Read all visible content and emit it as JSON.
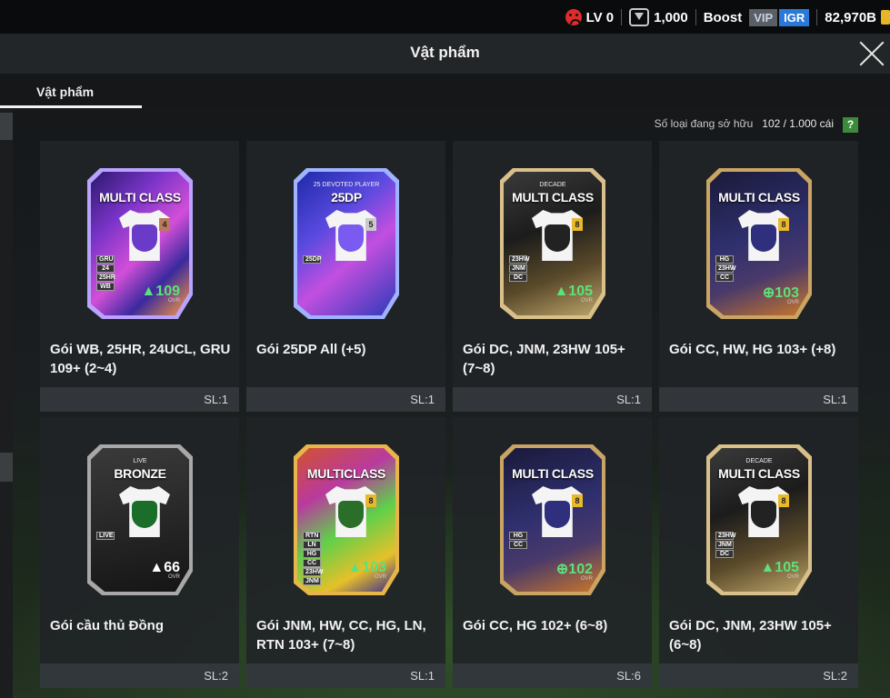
{
  "status": {
    "level": "LV 0",
    "points": "1,000",
    "boost": "Boost",
    "vip": "VIP",
    "igr": "IGR",
    "balance": "82,970B"
  },
  "header": {
    "title": "Vật phẩm"
  },
  "tabs": [
    {
      "label": "Vật phẩm",
      "active": true
    }
  ],
  "owned": {
    "label": "Số loại đang sở hữu",
    "value": "102 / 1.000 cái",
    "help": "?"
  },
  "items": [
    {
      "name": "Gói WB, 25HR, 24UCL, GRU 109+ (2~4)",
      "qty": "SL:1",
      "card": {
        "title": "MULTI CLASS",
        "subtitle": "",
        "num": "4",
        "ovr": "▲109",
        "ovr_label": "OVR",
        "tags": [
          "GRU",
          "24",
          "25HR",
          "WB"
        ],
        "style": "purple",
        "numcolor": "#b87a5a"
      }
    },
    {
      "name": "Gói 25DP All (+5)",
      "qty": "SL:1",
      "card": {
        "title": "25DP",
        "subtitle": "25 DEVOTED PLAYER",
        "num": "5",
        "ovr": "",
        "ovr_label": "",
        "tags": [
          "25DP"
        ],
        "style": "violet",
        "numcolor": "#c9c9c9"
      }
    },
    {
      "name": "Gói DC, JNM, 23HW 105+ (7~8)",
      "qty": "SL:1",
      "card": {
        "title": "MULTI CLASS",
        "subtitle": "DECADE",
        "num": "8",
        "ovr": "▲105",
        "ovr_label": "OVR",
        "tags": [
          "23HW",
          "JNM",
          "DC"
        ],
        "style": "decade",
        "numcolor": "#e8b92a"
      }
    },
    {
      "name": "Gói CC, HW, HG 103+ (+8)",
      "qty": "SL:1",
      "card": {
        "title": "MULTI CLASS",
        "subtitle": "",
        "num": "8",
        "ovr": "⊕103",
        "ovr_label": "OVR",
        "tags": [
          "HG",
          "23HW",
          "CC"
        ],
        "style": "navy",
        "numcolor": "#e8b92a"
      }
    },
    {
      "name": "Gói cầu thủ Đồng",
      "qty": "SL:2",
      "card": {
        "title": "BRONZE",
        "subtitle": "LIVE",
        "num": "",
        "ovr": "▲66",
        "ovr_label": "OVR",
        "tags": [
          "LIVE"
        ],
        "style": "live",
        "numcolor": ""
      }
    },
    {
      "name": "Gói JNM, HW, CC, HG, LN, RTN 103+ (7~8)",
      "qty": "SL:1",
      "card": {
        "title": "MULTICLASS",
        "subtitle": "",
        "num": "8",
        "ovr": "▲103",
        "ovr_label": "OVR",
        "tags": [
          "RTN",
          "LN",
          "HG",
          "CC",
          "23HW",
          "JNM"
        ],
        "style": "rainbow",
        "numcolor": "#e8b92a"
      }
    },
    {
      "name": "Gói CC, HG 102+ (6~8)",
      "qty": "SL:6",
      "card": {
        "title": "MULTI CLASS",
        "subtitle": "",
        "num": "8",
        "ovr": "⊕102",
        "ovr_label": "OVR",
        "tags": [
          "HG",
          "CC"
        ],
        "style": "navy",
        "numcolor": "#e8b92a"
      }
    },
    {
      "name": "Gói DC, JNM, 23HW 105+ (6~8)",
      "qty": "SL:2",
      "card": {
        "title": "MULTI CLASS",
        "subtitle": "DECADE",
        "num": "8",
        "ovr": "▲105",
        "ovr_label": "OVR",
        "tags": [
          "23HW",
          "JNM",
          "DC"
        ],
        "style": "decade",
        "numcolor": "#e8b92a"
      }
    }
  ],
  "colors": {
    "purple": "#7b34c9",
    "violet": "#5a4ae0",
    "decade": "#bca46a",
    "navy": "#2f2f6e",
    "live": "#3a3a3a",
    "rainbow": "#d2512f",
    "ovr_green": "#5ee07a"
  }
}
